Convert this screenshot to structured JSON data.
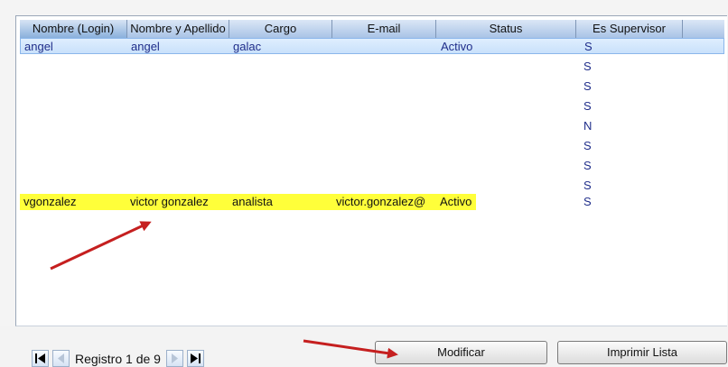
{
  "table": {
    "columns": [
      "Nombre (Login)",
      "Nombre y Apellido",
      "Cargo",
      "E-mail",
      "Status",
      "Es Supervisor"
    ],
    "rows": [
      {
        "login": "angel",
        "name": "angel",
        "cargo": "galac",
        "email": "",
        "status": "Activo",
        "supervisor": "S"
      },
      {
        "login": "",
        "name": "",
        "cargo": "",
        "email": "",
        "status": "",
        "supervisor": "S"
      },
      {
        "login": "",
        "name": "",
        "cargo": "",
        "email": "",
        "status": "",
        "supervisor": "S"
      },
      {
        "login": "",
        "name": "",
        "cargo": "",
        "email": "",
        "status": "",
        "supervisor": "S"
      },
      {
        "login": "",
        "name": "",
        "cargo": "",
        "email": "",
        "status": "",
        "supervisor": "N"
      },
      {
        "login": "",
        "name": "",
        "cargo": "",
        "email": "",
        "status": "",
        "supervisor": "S"
      },
      {
        "login": "",
        "name": "",
        "cargo": "",
        "email": "",
        "status": "",
        "supervisor": "S"
      },
      {
        "login": "",
        "name": "",
        "cargo": "",
        "email": "",
        "status": "",
        "supervisor": "S"
      },
      {
        "login": "vgonzalez",
        "name": "victor gonzalez",
        "cargo": "analista",
        "email": "victor.gonzalez@",
        "status": "Activo",
        "supervisor": "S"
      }
    ]
  },
  "navigation": {
    "record_label": "Registro 1 de 9"
  },
  "buttons": {
    "modify": "Modificar",
    "print_list": "Imprimir Lista"
  },
  "colors": {
    "header_blue": "#a9c3e6",
    "selected_row": "#c9e1fb",
    "highlight_yellow": "#ffff3a",
    "annotation_arrow": "#c51f1f"
  },
  "icons": {
    "first_record": "first-record-icon",
    "previous_record": "previous-record-icon",
    "next_record": "next-record-icon",
    "last_record": "last-record-icon",
    "annotation": "red-arrow-icon"
  }
}
